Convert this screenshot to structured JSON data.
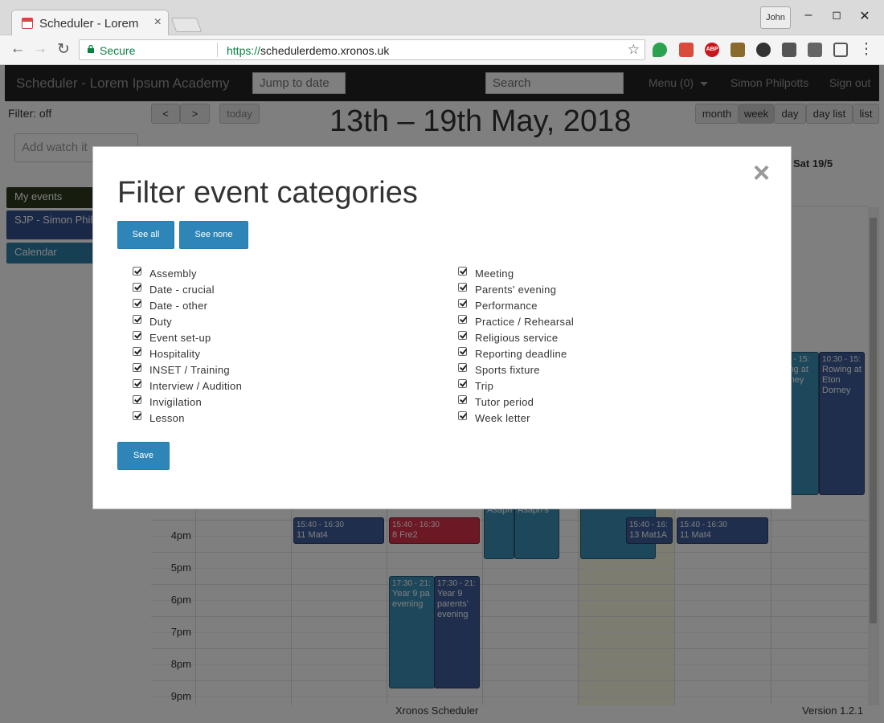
{
  "browser": {
    "tab_title": "Scheduler - Lorem Ipsum Academy",
    "tab_close": "×",
    "profile_name": "John",
    "url_secure_label": "Secure",
    "url_scheme": "https://",
    "url_host": "schedulerdemo.xronos.uk"
  },
  "navbar": {
    "brand": "Scheduler - Lorem Ipsum Academy",
    "jump_placeholder": "Jump to date",
    "search_placeholder": "Search",
    "menu_label": "Menu (0)",
    "user_name": "Simon Philpotts",
    "sign_out": "Sign out"
  },
  "sidebar": {
    "filter_status": "Filter: off",
    "watch_placeholder": "Add watch it",
    "items": [
      {
        "label": "My events",
        "color": "#2d3b1f"
      },
      {
        "label": "SJP - Simon Philpotts",
        "color": "#33508f"
      },
      {
        "label": "Calendar",
        "color": "#2d7ea8"
      }
    ]
  },
  "calendar": {
    "prev": "<",
    "next": ">",
    "today": "today",
    "title": "13th – 19th May, 2018",
    "views": [
      "month",
      "week",
      "day",
      "day list",
      "list"
    ],
    "active_view": "week",
    "visible_day_header": "Sat 19/5",
    "time_labels": [
      "4pm",
      "5pm",
      "6pm",
      "7pm",
      "8pm",
      "9pm"
    ],
    "events": [
      {
        "time": "15:40 - 16:30",
        "title": "11 Mat4",
        "color": "#3e5d9a"
      },
      {
        "time": "15:40 - 16:30",
        "title": "8 Fre2",
        "color": "#d9304a"
      },
      {
        "time": "15:40 - 16:",
        "title": "13 Mat1A",
        "color": "#3e5d9a"
      },
      {
        "time": "15:40 - 16:30",
        "title": "11 Mat4",
        "color": "#3e5d9a"
      },
      {
        "time": "17:30 - 21:",
        "title": "Year 9 pa evening",
        "color": "#3a8fb5"
      },
      {
        "time": "17:30 - 21:",
        "title": "Year 9 parents' evening",
        "color": "#3e5d9a"
      },
      {
        "time": "",
        "title": "Asaph",
        "color": "#3a8fb5"
      },
      {
        "time": "",
        "title": "Asaph's",
        "color": "#3a8fb5"
      },
      {
        "time": "10:30 - 15:",
        "title": "Rowing at Eton Dorney",
        "color": "#3e5d9a"
      },
      {
        "time": "0 - 15:",
        "title": "ing at rney",
        "color": "#3a8fb5"
      }
    ]
  },
  "footer": {
    "center": "Xronos Scheduler",
    "version": "Version 1.2.1"
  },
  "modal": {
    "title": "Filter event categories",
    "see_all": "See all",
    "see_none": "See none",
    "save": "Save",
    "close": "×",
    "categories_left": [
      "Assembly",
      "Date - crucial",
      "Date - other",
      "Duty",
      "Event set-up",
      "Hospitality",
      "INSET / Training",
      "Interview / Audition",
      "Invigilation",
      "Lesson"
    ],
    "categories_right": [
      "Meeting",
      "Parents' evening",
      "Performance",
      "Practice / Rehearsal",
      "Religious service",
      "Reporting deadline",
      "Sports fixture",
      "Trip",
      "Tutor period",
      "Week letter"
    ]
  }
}
